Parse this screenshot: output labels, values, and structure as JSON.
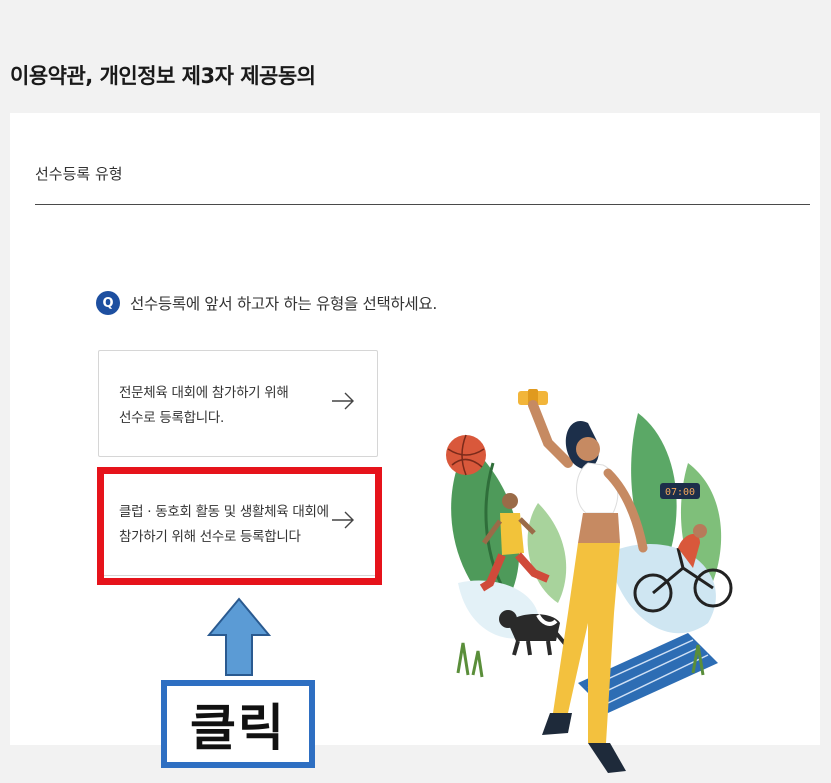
{
  "page": {
    "title": "이용약관, 개인정보 제3자 제공동의"
  },
  "section": {
    "label": "선수등록 유형"
  },
  "question": {
    "badge": "Q",
    "text": "선수등록에 앞서 하고자 하는 유형을 선택하세요."
  },
  "options": [
    {
      "line1": "전문체육 대회에 참가하기 위해",
      "line2": "선수로 등록합니다.",
      "arrow_icon": "arrow-right-icon"
    },
    {
      "line1": "클럽 · 동호회 활동 및 생활체육 대회에",
      "line2": "참가하기 위해 선수로 등록합니다",
      "arrow_icon": "arrow-right-icon"
    }
  ],
  "illustration": {
    "clock_text": "07:00"
  },
  "annotation": {
    "click_label": "클릭",
    "highlight_color": "#e6131b",
    "arrow_color": "#5b9bd5",
    "click_border_color": "#2e6fc2"
  },
  "colors": {
    "badge": "#1d4fa0",
    "divider": "#4a4a4a"
  }
}
